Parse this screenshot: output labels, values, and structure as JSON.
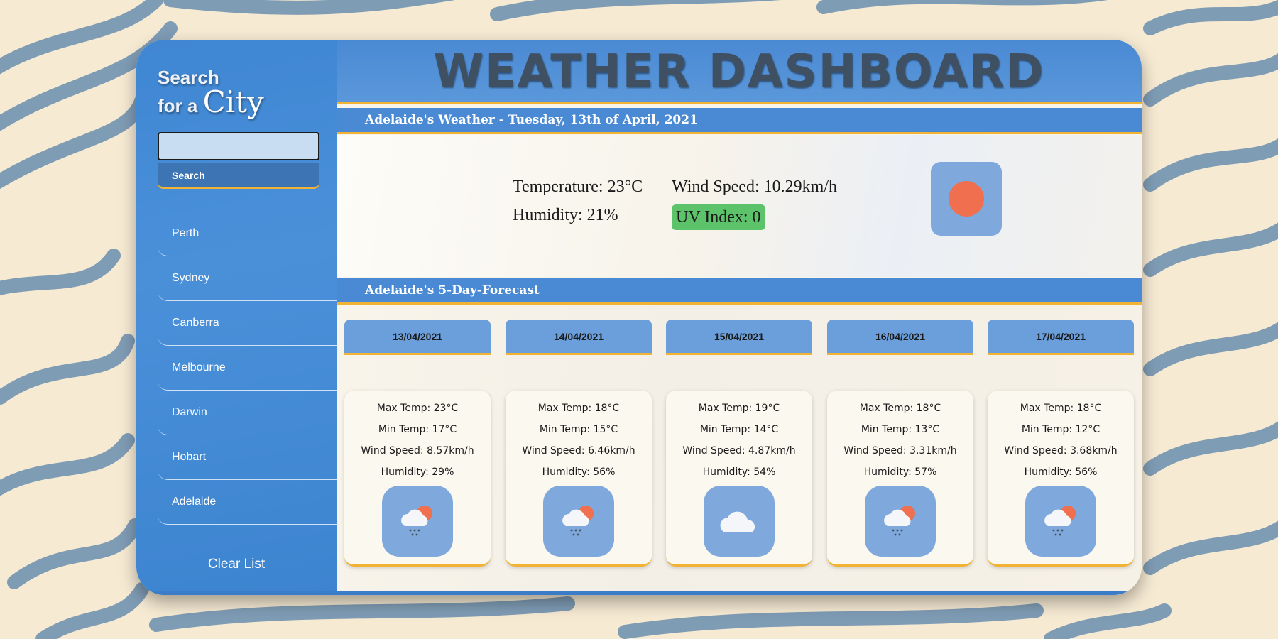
{
  "sidebar": {
    "title_line1": "Search",
    "title_line2_prefix": "for a",
    "title_line2_city": "City",
    "search_value": "",
    "search_button": "Search",
    "history": [
      "Perth",
      "Sydney",
      "Canberra",
      "Melbourne",
      "Darwin",
      "Hobart",
      "Adelaide"
    ],
    "clear_button": "Clear List"
  },
  "header": {
    "title": "WEATHER DASHBOARD"
  },
  "current": {
    "heading": "Adelaide's Weather - Tuesday, 13th of April, 2021",
    "temperature": "Temperature: 23°C",
    "wind_speed": "Wind Speed: 10.29km/h",
    "humidity": "Humidity: 21%",
    "uv_index": "UV Index: 0",
    "icon": "sun-icon",
    "uv_color": "#5cc36a"
  },
  "forecast": {
    "heading": "Adelaide's 5-Day-Forecast",
    "days": [
      {
        "date": "13/04/2021",
        "max": "Max Temp: 23°C",
        "min": "Min Temp: 17°C",
        "wind": "Wind Speed: 8.57km/h",
        "humidity": "Humidity: 29%",
        "icon": "rain-sun-cloud-icon"
      },
      {
        "date": "14/04/2021",
        "max": "Max Temp: 18°C",
        "min": "Min Temp: 15°C",
        "wind": "Wind Speed: 6.46km/h",
        "humidity": "Humidity: 56%",
        "icon": "rain-sun-cloud-icon"
      },
      {
        "date": "15/04/2021",
        "max": "Max Temp: 19°C",
        "min": "Min Temp: 14°C",
        "wind": "Wind Speed: 4.87km/h",
        "humidity": "Humidity: 54%",
        "icon": "cloud-icon"
      },
      {
        "date": "16/04/2021",
        "max": "Max Temp: 18°C",
        "min": "Min Temp: 13°C",
        "wind": "Wind Speed: 3.31km/h",
        "humidity": "Humidity: 57%",
        "icon": "rain-sun-cloud-icon"
      },
      {
        "date": "17/04/2021",
        "max": "Max Temp: 18°C",
        "min": "Min Temp: 12°C",
        "wind": "Wind Speed: 3.68km/h",
        "humidity": "Humidity: 56%",
        "icon": "rain-sun-cloud-icon"
      }
    ]
  },
  "colors": {
    "accent_blue": "#4a8ad4",
    "gold": "#f2b233",
    "sun": "#ef6f4e",
    "page_background": "#f6ead3",
    "pattern": "#7f9cb5"
  }
}
